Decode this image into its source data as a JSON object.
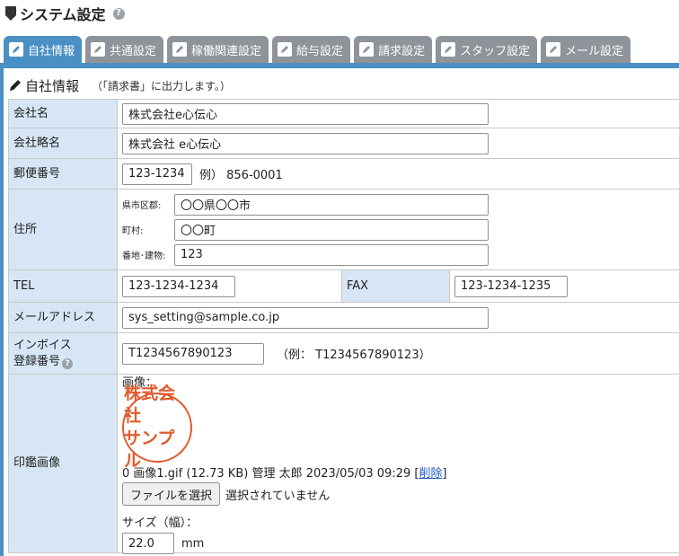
{
  "header": {
    "title": "システム設定",
    "help": "?"
  },
  "tabs": [
    {
      "label": "自社情報",
      "active": true
    },
    {
      "label": "共通設定",
      "active": false
    },
    {
      "label": "稼働関連設定",
      "active": false
    },
    {
      "label": "給与設定",
      "active": false
    },
    {
      "label": "請求設定",
      "active": false
    },
    {
      "label": "スタッフ設定",
      "active": false
    },
    {
      "label": "メール設定",
      "active": false
    }
  ],
  "section": {
    "title": "自社情報",
    "note": "（「請求書」に出力します。）"
  },
  "form": {
    "company_name": {
      "label": "会社名",
      "value": "株式会社e心伝心"
    },
    "company_short": {
      "label": "会社略名",
      "value": "株式会社 e心伝心"
    },
    "postal": {
      "label": "郵便番号",
      "value": "123-1234",
      "example": "例） 856-0001"
    },
    "address": {
      "label": "住所",
      "pref_label": "県市区郡:",
      "pref_value": "〇〇県〇〇市",
      "town_label": "町村:",
      "town_value": "〇〇町",
      "street_label": "番地･建物:",
      "street_value": "123"
    },
    "tel": {
      "label": "TEL",
      "value": "123-1234-1234"
    },
    "fax": {
      "label": "FAX",
      "value": "123-1234-1235"
    },
    "email": {
      "label": "メールアドレス",
      "value": "sys_setting@sample.co.jp"
    },
    "invoice": {
      "label_line1": "インボイス",
      "label_line2": "登録番号",
      "value": "T1234567890123",
      "example": "（例： T1234567890123）"
    },
    "seal": {
      "label": "印鑑画像",
      "image_label": "画像：",
      "seal_line1": "株式会社",
      "seal_line2": "サンプル",
      "file_info": "0 画像1.gif (12.73 KB) 管理 太郎 2023/05/03 09:29",
      "delete_link": "削除",
      "choose_button": "ファイルを選択",
      "no_file": "選択されていません",
      "size_label": "サイズ（幅）：",
      "size_value": "22.0",
      "size_unit": "mm"
    }
  },
  "colors": {
    "tab_active": "#4a90c4",
    "tab_inactive": "#8e9499",
    "label_bg": "#d6e6f4",
    "seal": "#e05a2b"
  }
}
